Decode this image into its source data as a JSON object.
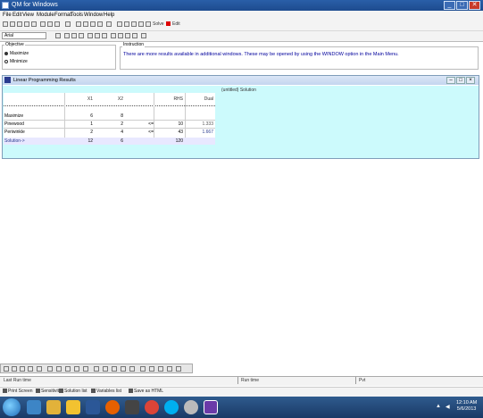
{
  "window": {
    "title": "QM for Windows",
    "min": "_",
    "max": "□",
    "close": "✕"
  },
  "menu": [
    "File",
    "Edit",
    "View",
    "Module",
    "Format",
    "Tools",
    "Window",
    "Help"
  ],
  "toolbar": {
    "solve_label": "Solve",
    "edit_label": "Edit",
    "font_field": "Arial"
  },
  "options": {
    "objective_legend": "Objective",
    "maximize_label": "Maximize",
    "minimize_label": "Minimize",
    "instructions_legend": "Instruction",
    "instruction_text": "There are more results available in additional windows. These may be opened by using the WINDOW option in the Main Menu."
  },
  "results_window": {
    "title": "Linear Programming Results",
    "subtitle": "(untitled) Solution",
    "columns": [
      "X1",
      "X2",
      "",
      "RHS",
      "Dual"
    ],
    "rows": [
      {
        "label": "Maximize",
        "values": [
          "6",
          "8",
          "",
          "",
          ""
        ]
      },
      {
        "label": "Pinewood",
        "values": [
          "1",
          "2",
          "<=",
          "10",
          "1.333"
        ]
      },
      {
        "label": "Periwinkle",
        "values": [
          "2",
          "4",
          "<=",
          "43",
          "1.667"
        ]
      },
      {
        "label": "Solution->",
        "values": [
          "12",
          "6",
          "",
          "120",
          ""
        ]
      }
    ]
  },
  "statusbar": {
    "left": "Last Run time",
    "mid": "Run time",
    "right": "Pvt"
  },
  "tabs": [
    "Print Screen",
    "Sensitivity",
    "Solution list",
    "Variables list",
    "Save as HTML"
  ],
  "clock": {
    "time": "12:10 AM",
    "date": "5/6/2013"
  },
  "colors": {
    "titlebar": "#1d4b8f",
    "grid_bg": "#ccfafc",
    "instruction": "#00009c",
    "taskbar": "#1a3a66"
  }
}
